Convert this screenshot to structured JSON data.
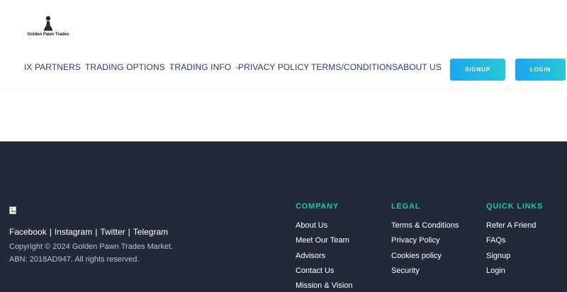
{
  "brand": {
    "name": "Golden Pawn Trades",
    "logo_icon": "chess-pawn-icon"
  },
  "nav": {
    "items": [
      {
        "label": "IX PARTNERS",
        "dropdown": false
      },
      {
        "label": "TRADING OPTIONS",
        "dropdown": true
      },
      {
        "label": "TRADING INFO",
        "dropdown": true
      },
      {
        "label": "PRIVACY POLICY",
        "dropdown": false
      },
      {
        "label": "TERMS/CONDITIONS",
        "dropdown": false
      },
      {
        "label": "ABOUT US",
        "dropdown": false
      }
    ],
    "chevron": "⌄"
  },
  "buttons": {
    "signup": "SIGNUP",
    "login": "LOGIN"
  },
  "footer": {
    "social": [
      "Facebook",
      "Instagram",
      "Twitter",
      "Telegram"
    ],
    "separator": "|",
    "copyright": "Copyright © 2024 Golden Pawn Trades Market.",
    "abn": "ABN: 2018AD947. All rights reserved.",
    "columns": {
      "company": {
        "title": "COMPANY",
        "items": [
          "About Us",
          "Meet Our Team",
          "Advisors",
          "Contact Us",
          "Mission & Vision"
        ]
      },
      "legal": {
        "title": "LEGAL",
        "items": [
          "Terms & Conditions",
          "Privacy Policy",
          "Cookies policy",
          "Security"
        ]
      },
      "quick": {
        "title": "QUICK LINKS",
        "items": [
          "Refer A Friend",
          "FAQs",
          "Signup",
          "Login"
        ]
      }
    }
  },
  "colors": {
    "nav_text": "#2c3e66",
    "button_gradient_start": "#1aa6f0",
    "button_gradient_end": "#2bc6d6",
    "footer_bg": "#222a3a",
    "footer_heading": "#25c49a",
    "footer_muted": "#b8c0d2"
  }
}
